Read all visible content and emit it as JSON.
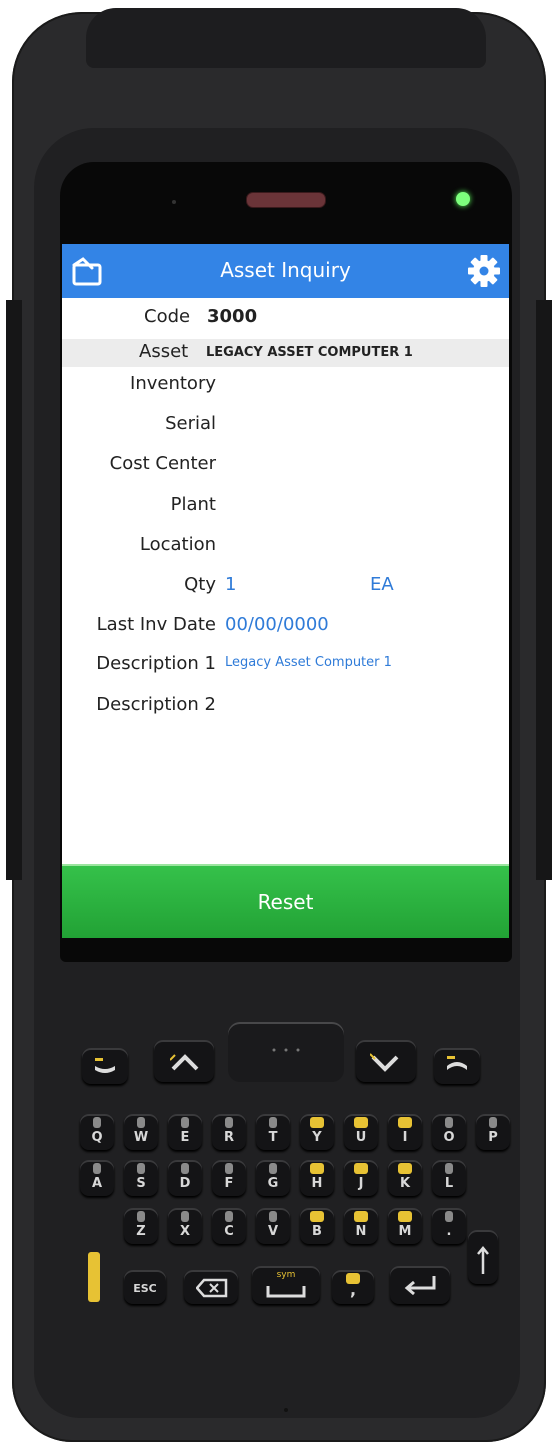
{
  "app": {
    "title": "Asset Inquiry",
    "accent_color": "#3384e6",
    "button_color": "#2bb13f"
  },
  "header_fields": {
    "code_label": "Code",
    "code_value": "3000",
    "asset_label": "Asset",
    "asset_value": "LEGACY ASSET COMPUTER 1"
  },
  "fields": {
    "inventory_label": "Inventory",
    "serial_label": "Serial",
    "cost_center_label": "Cost Center",
    "plant_label": "Plant",
    "location_label": "Location",
    "qty_label": "Qty",
    "qty_value": "1",
    "qty_unit": "EA",
    "last_inv_date_label": "Last Inv Date",
    "last_inv_date_value": "00/00/0000",
    "description1_label": "Description 1",
    "description1_value": "Legacy Asset Computer 1",
    "description2_label": "Description 2"
  },
  "actions": {
    "reset_label": "Reset"
  },
  "keypad": {
    "row1": [
      "Q",
      "W",
      "E",
      "R",
      "T",
      "Y",
      "U",
      "I",
      "O",
      "P"
    ],
    "row2": [
      "A",
      "S",
      "D",
      "F",
      "G",
      "H",
      "J",
      "K",
      "L"
    ],
    "row3": [
      "Z",
      "X",
      "C",
      "V",
      "B",
      "N",
      "M",
      "."
    ],
    "esc_label": "ESC",
    "sym_label": "sym"
  },
  "icons": {
    "back": "back-icon",
    "settings": "gear-icon"
  }
}
